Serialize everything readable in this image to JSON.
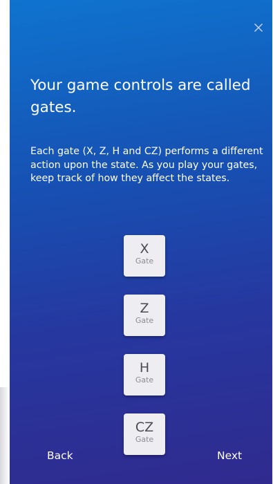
{
  "dialog": {
    "headline": "Your game controls are called gates.",
    "body": "Each gate (X, Z, H and CZ) performs a different action upon the state. As you play your gates, keep track of how they affect the states.",
    "close_icon": "close-icon"
  },
  "gates": [
    {
      "symbol": "X",
      "caption": "Gate"
    },
    {
      "symbol": "Z",
      "caption": "Gate"
    },
    {
      "symbol": "H",
      "caption": "Gate"
    },
    {
      "symbol": "CZ",
      "caption": "Gate"
    }
  ],
  "navigation": {
    "back_label": "Back",
    "next_label": "Next"
  },
  "colors": {
    "gradient_top": "#0f74cf",
    "gradient_bottom": "#302a8e",
    "gate_tile": "#eeeef2",
    "gate_symbol": "#4a4a55",
    "text": "#ffffff"
  }
}
